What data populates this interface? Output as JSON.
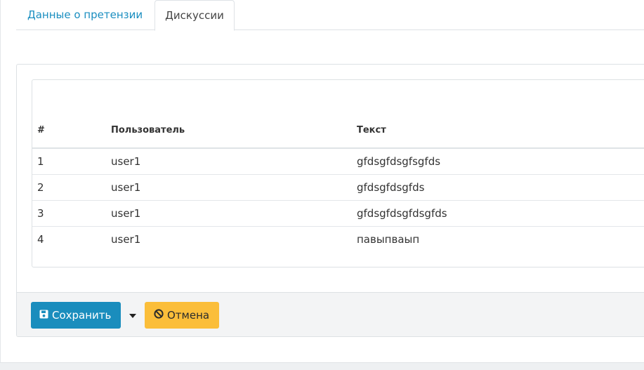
{
  "tabs": [
    {
      "label": "Данные о претензии",
      "active": false
    },
    {
      "label": "Дискуссии",
      "active": true
    }
  ],
  "table": {
    "headers": [
      "#",
      "Пользователь",
      "Текст"
    ],
    "rows": [
      {
        "num": "1",
        "user": "user1",
        "text": "gfdsgfdsgfsgfds"
      },
      {
        "num": "2",
        "user": "user1",
        "text": "gfdsgfdsgfds"
      },
      {
        "num": "3",
        "user": "user1",
        "text": "gfdsgfdsgfdsgfds"
      },
      {
        "num": "4",
        "user": "user1",
        "text": "павыпваып"
      }
    ]
  },
  "footer": {
    "save_label": "Сохранить",
    "cancel_label": "Отмена",
    "save_icon": "floppy-disk-icon",
    "caret_icon": "caret-down-icon",
    "cancel_icon": "ban-icon"
  },
  "colors": {
    "primary": "#1a8dbd",
    "warning": "#fbbe3a",
    "link": "#1a8ec0"
  }
}
